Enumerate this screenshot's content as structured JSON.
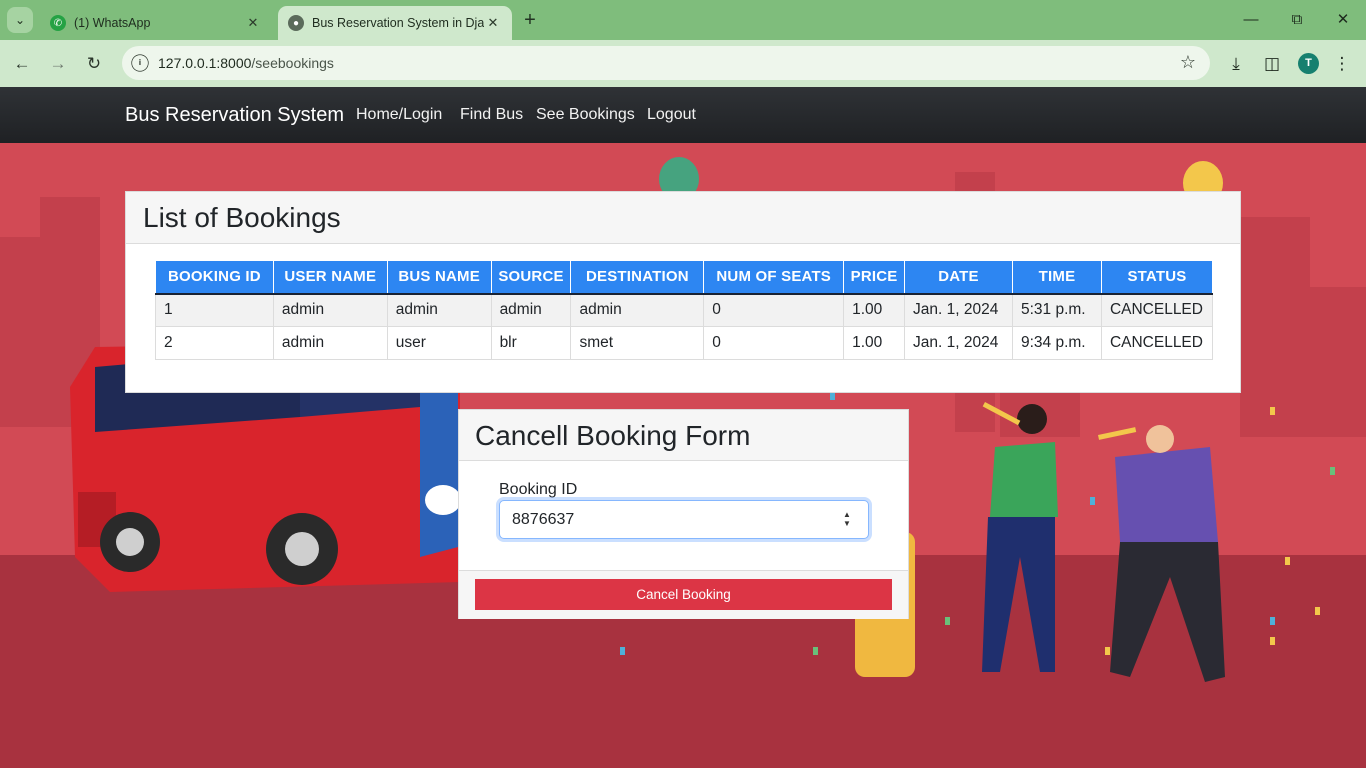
{
  "browser": {
    "tabs": [
      {
        "title": "(1) WhatsApp",
        "active": false
      },
      {
        "title": "Bus Reservation System in Djan",
        "active": true
      }
    ],
    "url_host": "127.0.0.1:8000",
    "url_path": "/seebookings",
    "profile_initial": "T"
  },
  "navbar": {
    "brand": "Bus Reservation System",
    "links": [
      "Home/Login",
      "Find Bus",
      "See Bookings",
      "Logout"
    ]
  },
  "bookings": {
    "title": "List of Bookings",
    "columns": [
      "BOOKING ID",
      "USER NAME",
      "BUS NAME",
      "SOURCE",
      "DESTINATION",
      "NUM OF SEATS",
      "PRICE",
      "DATE",
      "TIME",
      "STATUS"
    ],
    "rows": [
      [
        "1",
        "admin",
        "admin",
        "admin",
        "admin",
        "0",
        "1.00",
        "Jan. 1, 2024",
        "5:31 p.m.",
        "CANCELLED"
      ],
      [
        "2",
        "admin",
        "user",
        "blr",
        "smet",
        "0",
        "1.00",
        "Jan. 1, 2024",
        "9:34 p.m.",
        "CANCELLED"
      ]
    ]
  },
  "cancel_form": {
    "title": "Cancell Booking Form",
    "field_label": "Booking ID",
    "field_value": "8876637",
    "button_label": "Cancel Booking"
  },
  "colors": {
    "table_header": "#2d86f2",
    "button_danger": "#dc3545",
    "background": "#c7404a",
    "navbar": "#25272a"
  }
}
